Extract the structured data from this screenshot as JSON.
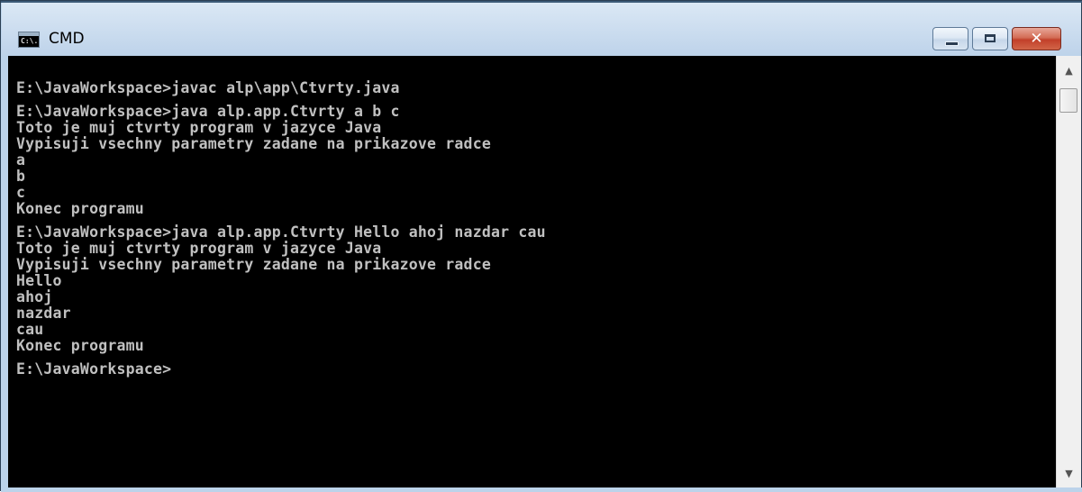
{
  "window": {
    "title": "CMD",
    "icon": "cmd-app-icon",
    "icon_text": "C:\\.",
    "buttons": {
      "minimize": "minimize-icon",
      "maximize": "maximize-icon",
      "close": "✕"
    }
  },
  "console": {
    "background": "#000000",
    "text_color": "#c0c0c0",
    "lines": [
      "E:\\JavaWorkspace>javac alp\\app\\Ctvrty.java",
      "",
      "E:\\JavaWorkspace>java alp.app.Ctvrty a b c",
      "Toto je muj ctvrty program v jazyce Java",
      "Vypisuji vsechny parametry zadane na prikazove radce",
      "a",
      "b",
      "c",
      "Konec programu",
      "",
      "E:\\JavaWorkspace>java alp.app.Ctvrty Hello ahoj nazdar cau",
      "Toto je muj ctvrty program v jazyce Java",
      "Vypisuji vsechny parametry zadane na prikazove radce",
      "Hello",
      "ahoj",
      "nazdar",
      "cau",
      "Konec programu",
      "",
      "E:\\JavaWorkspace>"
    ]
  },
  "scrollbar": {
    "up": "▲",
    "down": "▼"
  }
}
